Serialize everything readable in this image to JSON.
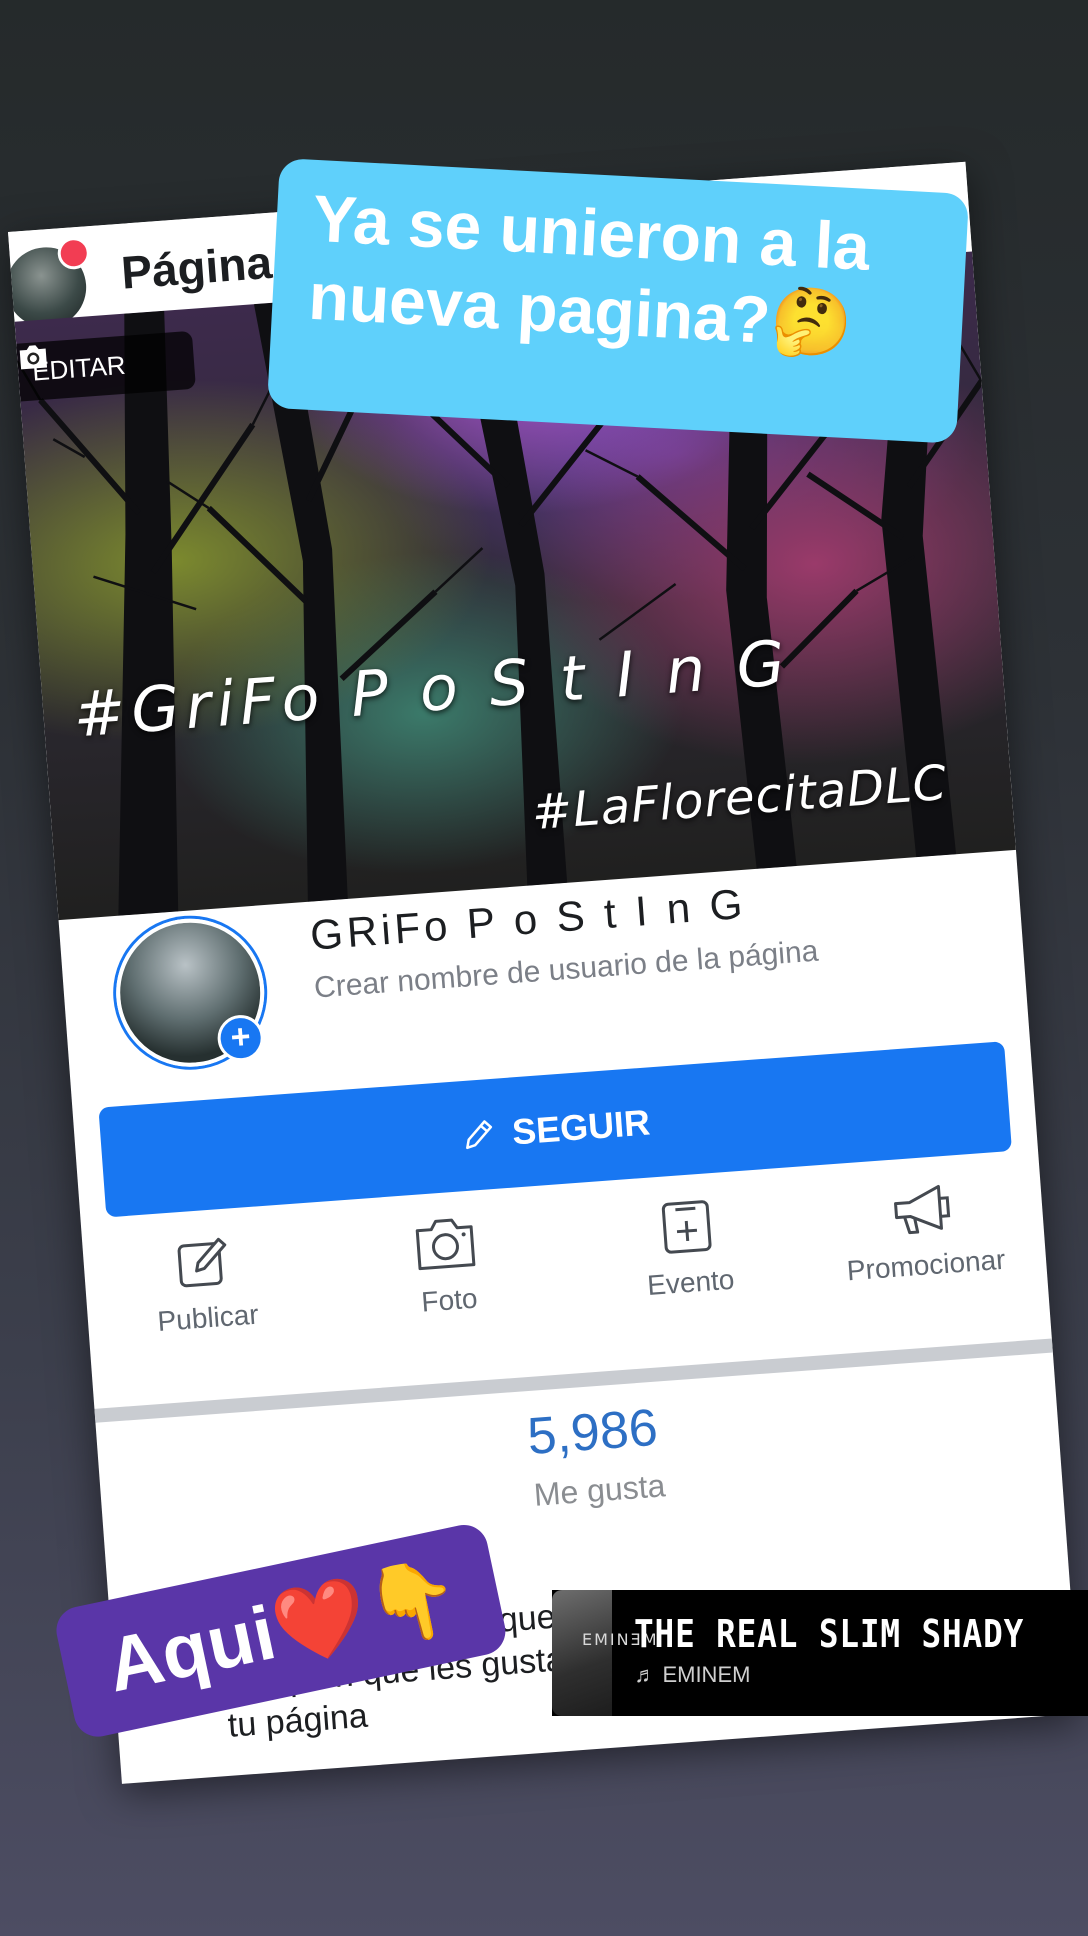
{
  "header": {
    "title": "Página"
  },
  "cover": {
    "edit_label": "EDITAR",
    "tag_main": "#GriFo P o S t I n G",
    "tag_secondary": "#LaFlorecitaDLC"
  },
  "page": {
    "name": "GRiFo P o S t I n G",
    "username_hint": "Crear nombre de usuario de la página"
  },
  "follow_button": {
    "label": "SEGUIR"
  },
  "actions": [
    {
      "label": "Publicar",
      "icon": "edit-icon"
    },
    {
      "label": "Foto",
      "icon": "camera-icon"
    },
    {
      "label": "Evento",
      "icon": "calendar-add-icon"
    },
    {
      "label": "Promocionar",
      "icon": "megaphone-icon"
    }
  ],
  "stats": {
    "likes_count": "5,986",
    "likes_label": "Me gusta"
  },
  "invite": {
    "text": "Invitar a amigos a que indiquen que les gusta tu página"
  },
  "story": {
    "caption_top": "Ya se unieron a la nueva pagina?🤔",
    "caption_bottom": "Aqui❤️👇"
  },
  "music": {
    "song": "THE REAL SLIM SHADY",
    "artist": "EMINEM",
    "album_brand": "EMINƎM"
  },
  "colors": {
    "accent": "#1877f2",
    "sticker_top": "#5fd0fb",
    "sticker_bottom": "#5a36a8",
    "notification": "#f23d53"
  }
}
